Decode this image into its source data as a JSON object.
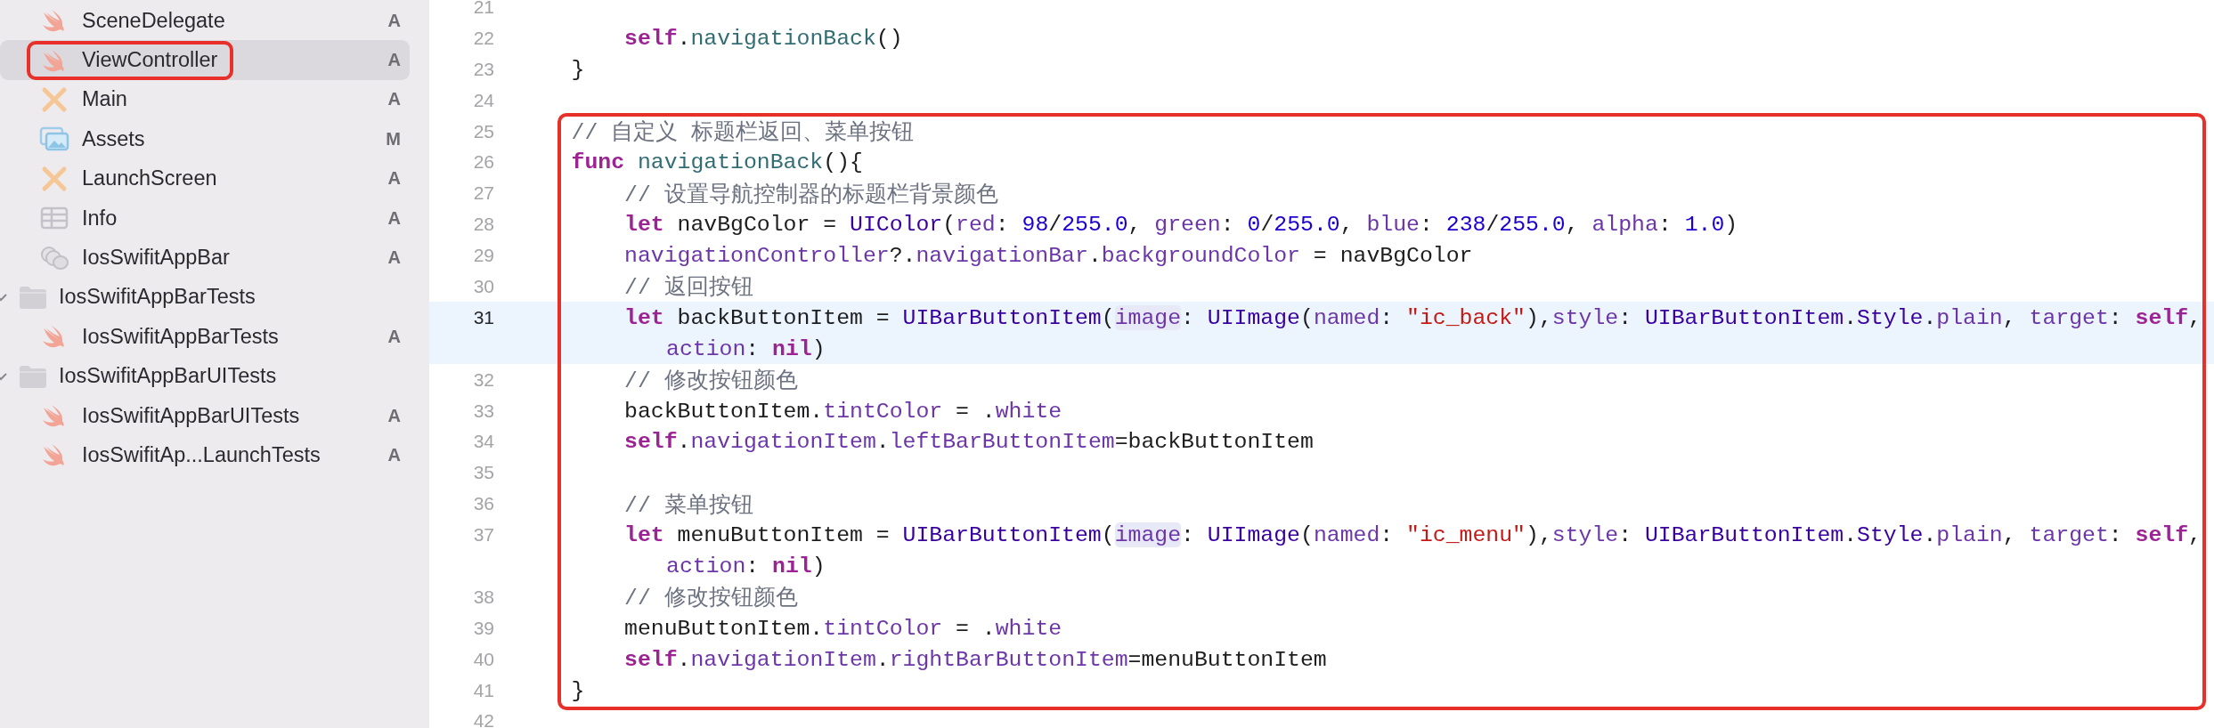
{
  "sidebar": {
    "files": [
      {
        "kind": "swift",
        "name": "SceneDelegate",
        "badge": "A",
        "selected": false,
        "marked": false
      },
      {
        "kind": "swift",
        "name": "ViewController",
        "badge": "A",
        "selected": true,
        "marked": true
      },
      {
        "kind": "interface",
        "name": "Main",
        "badge": "A",
        "selected": false,
        "marked": false
      },
      {
        "kind": "assets",
        "name": "Assets",
        "badge": "M",
        "selected": false,
        "marked": false
      },
      {
        "kind": "interface",
        "name": "LaunchScreen",
        "badge": "A",
        "selected": false,
        "marked": false
      },
      {
        "kind": "plist",
        "name": "Info",
        "badge": "A",
        "selected": false,
        "marked": false
      },
      {
        "kind": "target",
        "name": "IosSwifitAppBar",
        "badge": "A",
        "selected": false,
        "marked": false
      }
    ],
    "folders": [
      {
        "name": "IosSwifitAppBarTests",
        "expanded": true,
        "children": [
          {
            "kind": "swift",
            "name": "IosSwifitAppBarTests",
            "badge": "A",
            "selected": false,
            "marked": false
          }
        ]
      },
      {
        "name": "IosSwifitAppBarUITests",
        "expanded": true,
        "children": [
          {
            "kind": "swift",
            "name": "IosSwifitAppBarUITests",
            "badge": "A",
            "selected": false,
            "marked": false
          },
          {
            "kind": "swift",
            "name": "IosSwifitAp...LaunchTests",
            "badge": "A",
            "selected": false,
            "marked": false
          }
        ]
      }
    ]
  },
  "lines_above": [
    {
      "number": "21",
      "current": false
    },
    {
      "number": "22",
      "current": false,
      "tokens": [
        {
          "kind": "keyword",
          "text": "        self"
        },
        {
          "kind": "plain",
          "text": "."
        },
        {
          "kind": "function",
          "text": "navigationBack"
        },
        {
          "kind": "plain",
          "text": "()"
        }
      ]
    },
    {
      "number": "23",
      "current": false,
      "tokens": [
        {
          "kind": "plain",
          "text": "    }"
        }
      ]
    },
    {
      "number": "24",
      "current": false
    }
  ],
  "framed_lines": [
    {
      "number": "25",
      "current": false,
      "tokens": [
        {
          "kind": "comment",
          "text": "    // 自定义 标题栏返回、菜单按钮"
        }
      ]
    },
    {
      "number": "26",
      "current": false,
      "tokens": [
        {
          "kind": "keyword",
          "text": "    func"
        },
        {
          "kind": "function",
          "text": " navigationBack"
        },
        {
          "kind": "plain",
          "text": "(){"
        }
      ]
    },
    {
      "number": "27",
      "current": false,
      "tokens": [
        {
          "kind": "comment",
          "text": "        // 设置导航控制器的标题栏背景颜色"
        }
      ]
    },
    {
      "number": "28",
      "current": false,
      "tokens": [
        {
          "kind": "keyword",
          "text": "        let"
        },
        {
          "kind": "plain",
          "text": " navBgColor = "
        },
        {
          "kind": "type",
          "text": "UIColor"
        },
        {
          "kind": "plain",
          "text": "("
        },
        {
          "kind": "param",
          "text": "red"
        },
        {
          "kind": "plain",
          "text": ": "
        },
        {
          "kind": "number",
          "text": "98"
        },
        {
          "kind": "plain",
          "text": "/"
        },
        {
          "kind": "number",
          "text": "255.0"
        },
        {
          "kind": "plain",
          "text": ", "
        },
        {
          "kind": "param",
          "text": "green"
        },
        {
          "kind": "plain",
          "text": ": "
        },
        {
          "kind": "number",
          "text": "0"
        },
        {
          "kind": "plain",
          "text": "/"
        },
        {
          "kind": "number",
          "text": "255.0"
        },
        {
          "kind": "plain",
          "text": ", "
        },
        {
          "kind": "param",
          "text": "blue"
        },
        {
          "kind": "plain",
          "text": ": "
        },
        {
          "kind": "number",
          "text": "238"
        },
        {
          "kind": "plain",
          "text": "/"
        },
        {
          "kind": "number",
          "text": "255.0"
        },
        {
          "kind": "plain",
          "text": ", "
        },
        {
          "kind": "param",
          "text": "alpha"
        },
        {
          "kind": "plain",
          "text": ": "
        },
        {
          "kind": "number",
          "text": "1.0"
        },
        {
          "kind": "plain",
          "text": ")"
        }
      ]
    },
    {
      "number": "29",
      "current": false,
      "tokens": [
        {
          "kind": "property",
          "text": "        navigationController"
        },
        {
          "kind": "plain",
          "text": "?."
        },
        {
          "kind": "property",
          "text": "navigationBar"
        },
        {
          "kind": "plain",
          "text": "."
        },
        {
          "kind": "property",
          "text": "backgroundColor"
        },
        {
          "kind": "plain",
          "text": " = navBgColor"
        }
      ]
    },
    {
      "number": "30",
      "current": false,
      "tokens": [
        {
          "kind": "comment",
          "text": "        // 返回按钮"
        }
      ]
    },
    {
      "number": "31",
      "current": true,
      "tokens": [
        {
          "kind": "keyword",
          "text": "        let"
        },
        {
          "kind": "plain",
          "text": " backButtonItem = "
        },
        {
          "kind": "type",
          "text": "UIBarButtonItem"
        },
        {
          "kind": "plain",
          "text": "("
        },
        {
          "kind": "param-highlight",
          "text": "image"
        },
        {
          "kind": "plain",
          "text": ": "
        },
        {
          "kind": "type",
          "text": "UIImage"
        },
        {
          "kind": "plain",
          "text": "("
        },
        {
          "kind": "param",
          "text": "named"
        },
        {
          "kind": "plain",
          "text": ": "
        },
        {
          "kind": "string",
          "text": "\"ic_back\""
        },
        {
          "kind": "plain",
          "text": "),"
        },
        {
          "kind": "param",
          "text": "style"
        },
        {
          "kind": "plain",
          "text": ": "
        },
        {
          "kind": "type",
          "text": "UIBarButtonItem"
        },
        {
          "kind": "plain",
          "text": "."
        },
        {
          "kind": "type",
          "text": "Style"
        },
        {
          "kind": "plain",
          "text": "."
        },
        {
          "kind": "property",
          "text": "plain"
        },
        {
          "kind": "plain",
          "text": ", "
        },
        {
          "kind": "param",
          "text": "target"
        },
        {
          "kind": "plain",
          "text": ": "
        },
        {
          "kind": "keyword",
          "text": "self"
        },
        {
          "kind": "plain",
          "text": ","
        }
      ],
      "wrapped_tokens": [
        {
          "kind": "param",
          "text": "action"
        },
        {
          "kind": "plain",
          "text": ": "
        },
        {
          "kind": "keyword",
          "text": "nil"
        },
        {
          "kind": "plain",
          "text": ")"
        }
      ]
    },
    {
      "number": "32",
      "current": false,
      "tokens": [
        {
          "kind": "comment",
          "text": "        // 修改按钮颜色"
        }
      ]
    },
    {
      "number": "33",
      "current": false,
      "tokens": [
        {
          "kind": "plain",
          "text": "        backButtonItem."
        },
        {
          "kind": "property",
          "text": "tintColor"
        },
        {
          "kind": "plain",
          "text": " = ."
        },
        {
          "kind": "property",
          "text": "white"
        }
      ]
    },
    {
      "number": "34",
      "current": false,
      "tokens": [
        {
          "kind": "keyword",
          "text": "        self"
        },
        {
          "kind": "plain",
          "text": "."
        },
        {
          "kind": "property",
          "text": "navigationItem"
        },
        {
          "kind": "plain",
          "text": "."
        },
        {
          "kind": "property",
          "text": "leftBarButtonItem"
        },
        {
          "kind": "plain",
          "text": "=backButtonItem"
        }
      ]
    },
    {
      "number": "35",
      "current": false
    },
    {
      "number": "36",
      "current": false,
      "tokens": [
        {
          "kind": "comment",
          "text": "        // 菜单按钮"
        }
      ]
    },
    {
      "number": "37",
      "current": false,
      "tokens": [
        {
          "kind": "keyword",
          "text": "        let"
        },
        {
          "kind": "plain",
          "text": " menuButtonItem = "
        },
        {
          "kind": "type",
          "text": "UIBarButtonItem"
        },
        {
          "kind": "plain",
          "text": "("
        },
        {
          "kind": "param-highlight",
          "text": "image"
        },
        {
          "kind": "plain",
          "text": ": "
        },
        {
          "kind": "type",
          "text": "UIImage"
        },
        {
          "kind": "plain",
          "text": "("
        },
        {
          "kind": "param",
          "text": "named"
        },
        {
          "kind": "plain",
          "text": ": "
        },
        {
          "kind": "string",
          "text": "\"ic_menu\""
        },
        {
          "kind": "plain",
          "text": "),"
        },
        {
          "kind": "param",
          "text": "style"
        },
        {
          "kind": "plain",
          "text": ": "
        },
        {
          "kind": "type",
          "text": "UIBarButtonItem"
        },
        {
          "kind": "plain",
          "text": "."
        },
        {
          "kind": "type",
          "text": "Style"
        },
        {
          "kind": "plain",
          "text": "."
        },
        {
          "kind": "property",
          "text": "plain"
        },
        {
          "kind": "plain",
          "text": ", "
        },
        {
          "kind": "param",
          "text": "target"
        },
        {
          "kind": "plain",
          "text": ": "
        },
        {
          "kind": "keyword",
          "text": "self"
        },
        {
          "kind": "plain",
          "text": ","
        }
      ],
      "wrapped_tokens": [
        {
          "kind": "param",
          "text": "action"
        },
        {
          "kind": "plain",
          "text": ": "
        },
        {
          "kind": "keyword",
          "text": "nil"
        },
        {
          "kind": "plain",
          "text": ")"
        }
      ]
    },
    {
      "number": "38",
      "current": false,
      "tokens": [
        {
          "kind": "comment",
          "text": "        // 修改按钮颜色"
        }
      ]
    },
    {
      "number": "39",
      "current": false,
      "tokens": [
        {
          "kind": "plain",
          "text": "        menuButtonItem."
        },
        {
          "kind": "property",
          "text": "tintColor"
        },
        {
          "kind": "plain",
          "text": " = ."
        },
        {
          "kind": "property",
          "text": "white"
        }
      ]
    },
    {
      "number": "40",
      "current": false,
      "tokens": [
        {
          "kind": "keyword",
          "text": "        self"
        },
        {
          "kind": "plain",
          "text": "."
        },
        {
          "kind": "property",
          "text": "navigationItem"
        },
        {
          "kind": "plain",
          "text": "."
        },
        {
          "kind": "property",
          "text": "rightBarButtonItem"
        },
        {
          "kind": "plain",
          "text": "=menuButtonItem"
        }
      ]
    },
    {
      "number": "41",
      "current": false,
      "tokens": [
        {
          "kind": "plain",
          "text": "    }"
        }
      ]
    }
  ],
  "lines_below": [
    {
      "number": "42",
      "current": false
    }
  ]
}
